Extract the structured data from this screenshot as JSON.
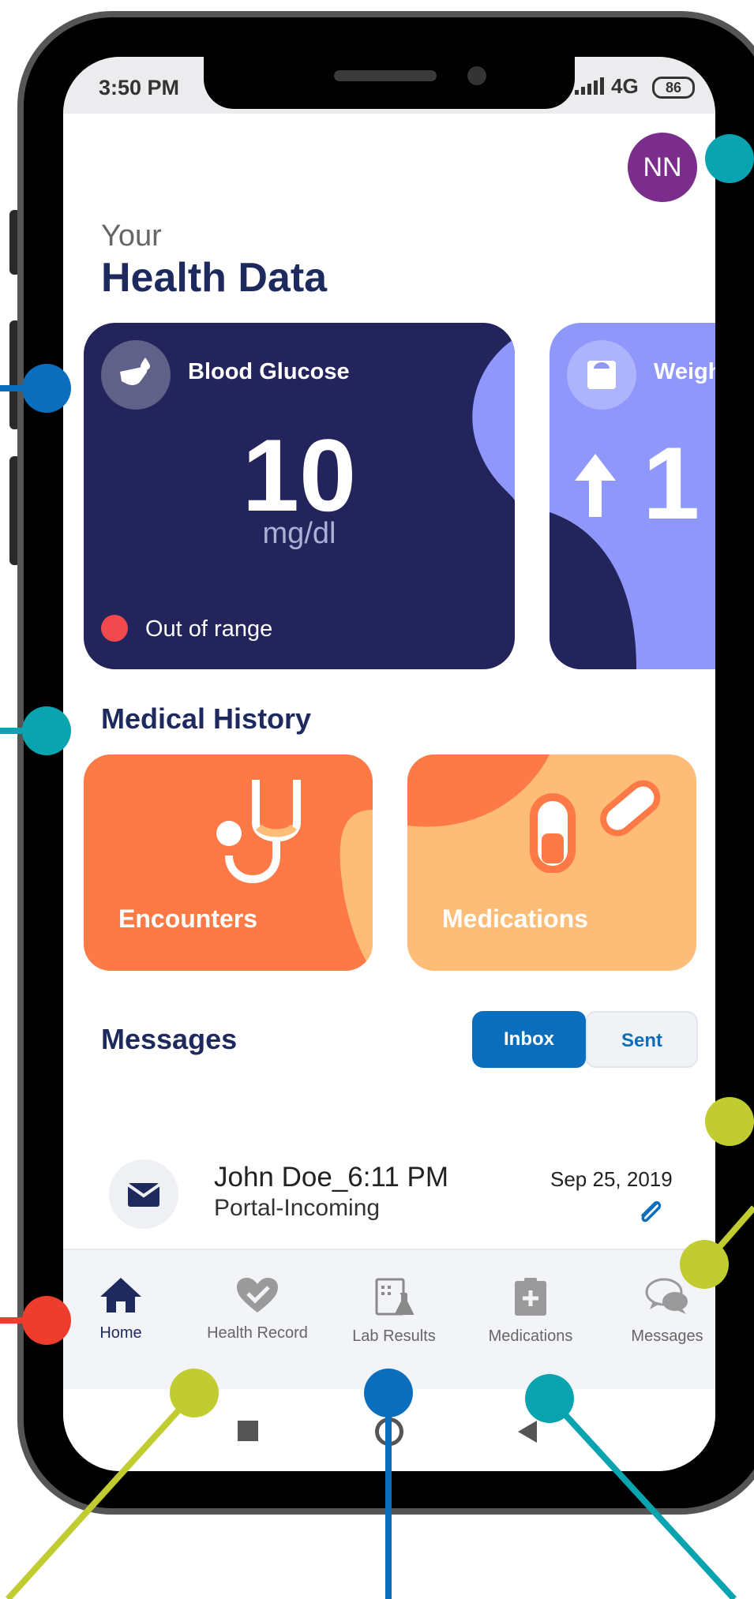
{
  "status_bar": {
    "time": "3:50 PM",
    "network": "4G",
    "battery": "86"
  },
  "header": {
    "avatar_initials": "NN",
    "greeting": "Your",
    "title": "Health Data"
  },
  "health_cards": [
    {
      "label": "Blood Glucose",
      "value": "10",
      "unit": "mg/dl",
      "status": "Out of range"
    },
    {
      "label": "Weigh",
      "value": "1"
    }
  ],
  "medical_history": {
    "title": "Medical History",
    "tiles": [
      {
        "label": "Encounters"
      },
      {
        "label": "Medications"
      }
    ]
  },
  "messages": {
    "title": "Messages",
    "tabs": [
      {
        "label": "Inbox"
      },
      {
        "label": "Sent"
      }
    ],
    "items": [
      {
        "name": "John Doe_6:11 PM",
        "subject": "Portal-Incoming",
        "date": "Sep 25, 2019"
      }
    ]
  },
  "bottom_nav": [
    {
      "label": "Home"
    },
    {
      "label": "Health Record"
    },
    {
      "label": "Lab Results"
    },
    {
      "label": "Medications"
    },
    {
      "label": "Messages"
    }
  ],
  "colors": {
    "navy": "#22245b",
    "periwinkle": "#8f97fb",
    "orange": "#fd7a46",
    "peach": "#fdbd78",
    "blue": "#0a6ebd",
    "teal": "#0aa3b0",
    "lime": "#c1cc30",
    "red": "#ee3d2c"
  }
}
